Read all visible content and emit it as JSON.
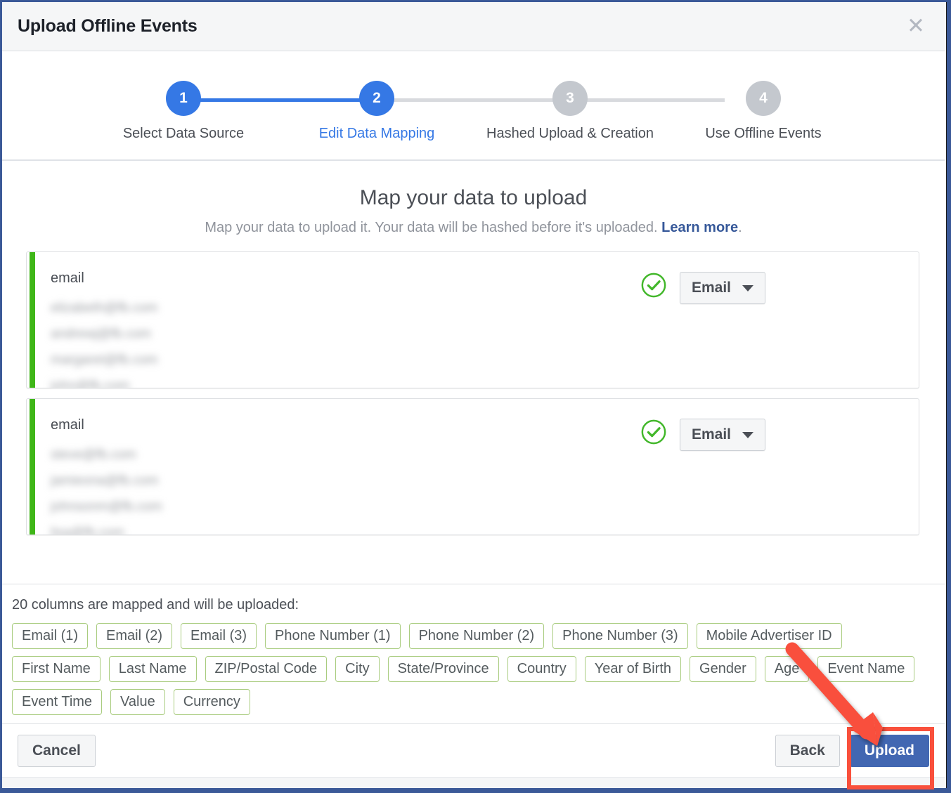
{
  "window": {
    "frame_color": "#3b5998"
  },
  "dialog": {
    "title": "Upload Offline Events",
    "close_label": "✕"
  },
  "stepper": {
    "steps": [
      {
        "number": "1",
        "label": "Select Data Source",
        "state": "done"
      },
      {
        "number": "2",
        "label": "Edit Data Mapping",
        "state": "active"
      },
      {
        "number": "3",
        "label": "Hashed Upload & Creation",
        "state": "pending"
      },
      {
        "number": "4",
        "label": "Use Offline Events",
        "state": "pending"
      }
    ],
    "active_color": "#3578e5",
    "pending_color": "#c4c8ce"
  },
  "body": {
    "title": "Map your data to upload",
    "subtitle_before": "Map your data to upload it. Your data will be hashed before it's uploaded. ",
    "subtitle_link": "Learn more",
    "subtitle_after": ".",
    "cards": [
      {
        "column_name": "email",
        "status": "valid",
        "mapped_to": "Email",
        "samples": [
          "elizabeth@fb.com",
          "andrewj@fb.com",
          "margaret@fb.com",
          "john@fb.com"
        ]
      },
      {
        "column_name": "email",
        "status": "valid",
        "mapped_to": "Email",
        "samples": [
          "steve@fb.com",
          "jamieona@fb.com",
          "johnsonm@fb.com",
          "lisa@fb.com"
        ]
      }
    ]
  },
  "summary": {
    "text": "20 columns are mapped and will be uploaded:",
    "chips": [
      "Email (1)",
      "Email (2)",
      "Email (3)",
      "Phone Number (1)",
      "Phone Number (2)",
      "Phone Number (3)",
      "Mobile Advertiser ID",
      "First Name",
      "Last Name",
      "ZIP/Postal Code",
      "City",
      "State/Province",
      "Country",
      "Year of Birth",
      "Gender",
      "Age",
      "Event Name",
      "Event Time",
      "Value",
      "Currency"
    ],
    "chip_border_color": "#a9cc7f"
  },
  "footer": {
    "cancel_label": "Cancel",
    "back_label": "Back",
    "upload_label": "Upload",
    "primary_color": "#4267b2"
  },
  "annotation": {
    "highlight_color": "#f9503c",
    "arrow_target": "upload-button"
  }
}
